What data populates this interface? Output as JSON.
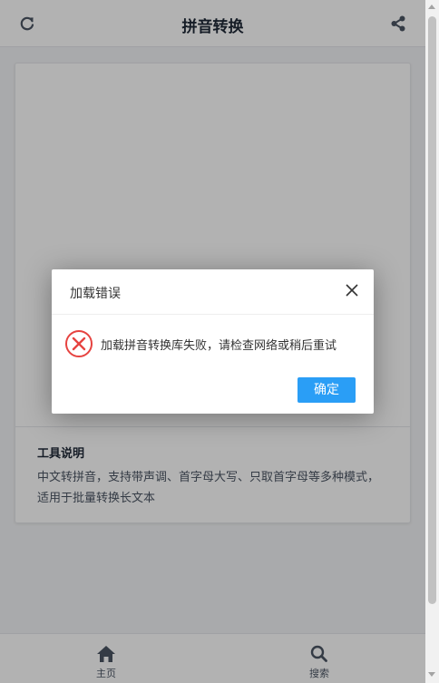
{
  "header": {
    "title": "拼音转换",
    "refresh_icon": "refresh-icon",
    "share_icon": "share-icon"
  },
  "info": {
    "title": "工具说明",
    "description": "中文转拼音，支持带声调、首字母大写、只取首字母等多种模式，适用于批量转换长文本"
  },
  "bottom_nav": {
    "items": [
      {
        "label": "主页",
        "icon": "home-icon"
      },
      {
        "label": "搜索",
        "icon": "search-icon"
      }
    ]
  },
  "dialog": {
    "title": "加载错误",
    "message": "加载拼音转换库失败，请检查网络或稍后重试",
    "confirm_label": "确定",
    "close_icon": "close-icon",
    "error_icon": "error-circle-icon"
  },
  "colors": {
    "accent": "#2a9ef6",
    "error": "#e64340",
    "icon": "#4b5563"
  }
}
